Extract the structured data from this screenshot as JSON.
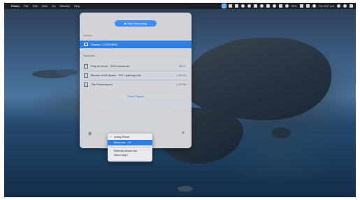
{
  "menubar": {
    "apple": "",
    "app_name": "Finder",
    "menus": [
      "File",
      "Edit",
      "View",
      "Go",
      "Window",
      "Help"
    ],
    "battery": "99%",
    "clock": "Thu 8:47 pm"
  },
  "panel": {
    "start_button": "▶ Start Streaming",
    "section_screens": "Screens",
    "display": "Display 1 (1280x800)",
    "section_media": "Media files",
    "media": [
      {
        "title": "Play at Home - 2019 school.avi",
        "duration": "00:17"
      },
      {
        "title": "Beware of 64 Space - 2017 (spring).m4v",
        "duration": "1:04:24"
      },
      {
        "title": "The Economy.avi",
        "duration": "1:47:08"
      }
    ],
    "clear_playlist": "Clear Playlist",
    "device_selector": "✓ Living Room"
  },
  "device_menu": {
    "items": [
      {
        "label": "Living Room",
        "checked": true
      },
      {
        "label": "Bedroom - TV",
        "checked": false,
        "highlighted": true
      }
    ],
    "refresh": "Refresh device list",
    "help": "Need help?"
  }
}
